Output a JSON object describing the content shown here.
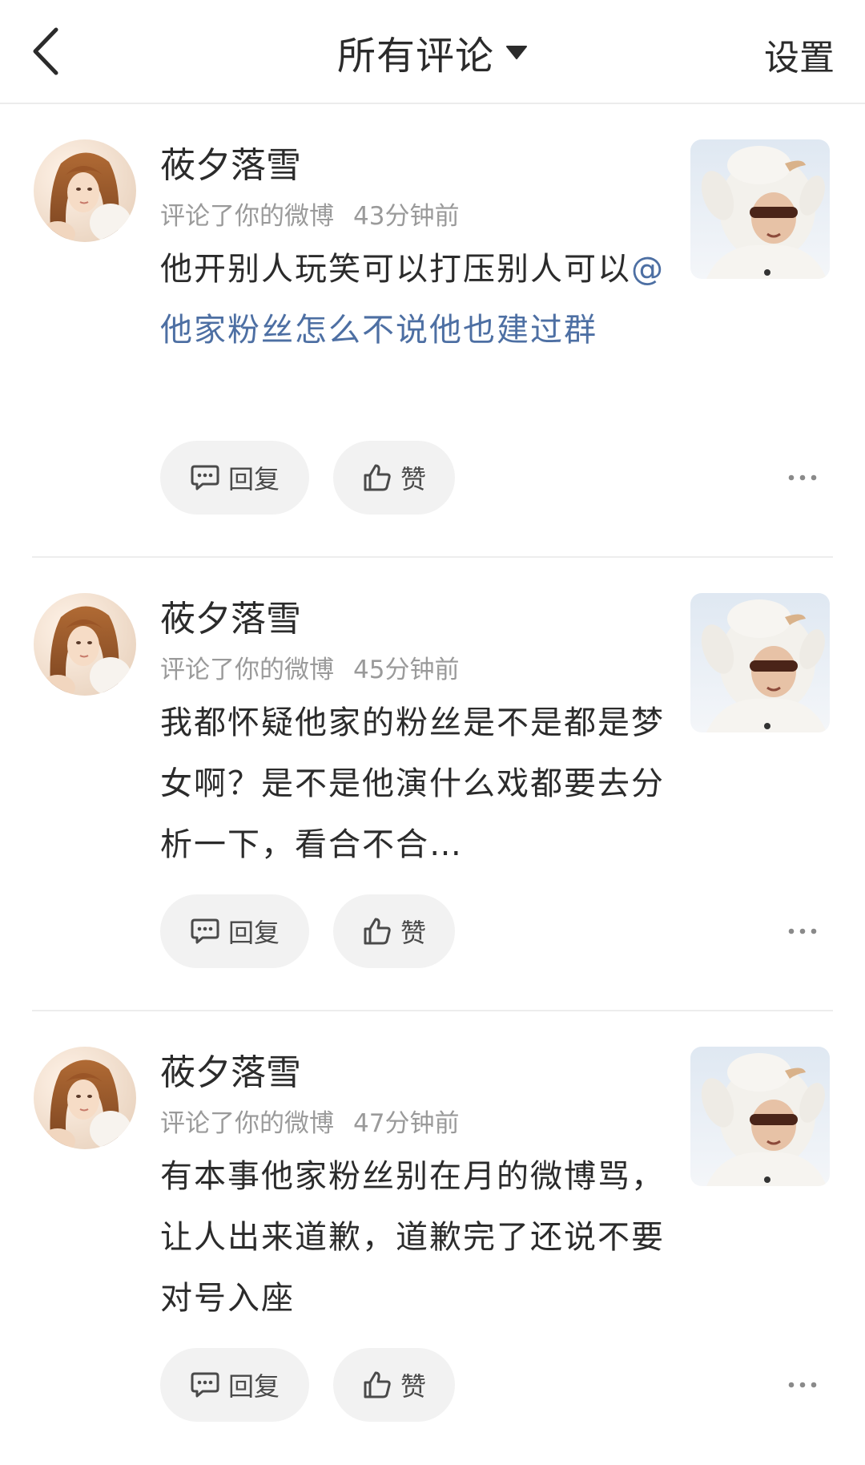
{
  "header": {
    "title": "所有评论",
    "settings_label": "设置"
  },
  "icons": {
    "back": "chevron-left-icon",
    "title_dropdown": "caret-down-icon",
    "reply": "comment-bubble-icon",
    "like": "thumbs-up-icon",
    "more": "more-dots-icon"
  },
  "colors": {
    "mention": "#4d6fa3",
    "meta": "#9a9a9a",
    "pill_bg": "#f2f2f2"
  },
  "comments": [
    {
      "username": "莜夕落雪",
      "action": "评论了你的微博",
      "time": "43分钟前",
      "text_before": "他开别人玩笑可以打压别人可以",
      "mention": "@他家粉丝怎么不说他也建过群",
      "reply_label": "回复",
      "like_label": "赞"
    },
    {
      "username": "莜夕落雪",
      "action": "评论了你的微博",
      "time": "45分钟前",
      "text_before": "我都怀疑他家的粉丝是不是都是梦女啊？是不是他演什么戏都要去分析一下，看合不合…",
      "mention": "",
      "reply_label": "回复",
      "like_label": "赞"
    },
    {
      "username": "莜夕落雪",
      "action": "评论了你的微博",
      "time": "47分钟前",
      "text_before": "有本事他家粉丝别在月的微博骂，让人出来道歉，道歉完了还说不要对号入座",
      "mention": "",
      "reply_label": "回复",
      "like_label": "赞"
    }
  ]
}
